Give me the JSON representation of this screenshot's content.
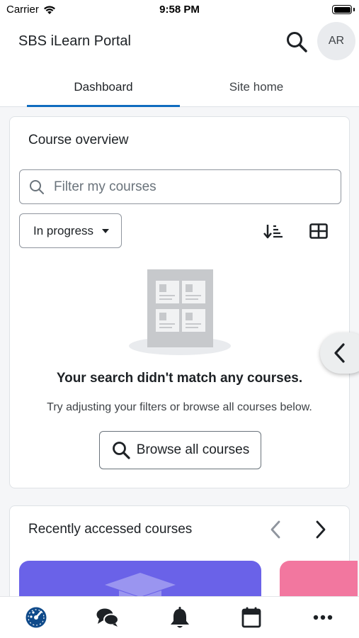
{
  "status_bar": {
    "carrier": "Carrier",
    "time": "9:58 PM"
  },
  "header": {
    "title": "SBS iLearn Portal",
    "avatar_initials": "AR"
  },
  "tabs": [
    {
      "label": "Dashboard",
      "active": true
    },
    {
      "label": "Site home",
      "active": false
    }
  ],
  "course_overview": {
    "title": "Course overview",
    "filter_placeholder": "Filter my courses",
    "grouping_selected": "In progress",
    "empty_title": "Your search didn't match any courses.",
    "empty_subtitle": "Try adjusting your filters or browse all courses below.",
    "browse_label": "Browse all courses"
  },
  "recent_courses": {
    "title": "Recently accessed courses",
    "tile_colors": [
      "#6a62e8",
      "#f2779f"
    ]
  },
  "bottom_tabs": [
    "dashboard-icon",
    "messages-icon",
    "notifications-icon",
    "calendar-icon",
    "more-icon"
  ],
  "colors": {
    "accent": "#0f6cbf",
    "dashboard_active": "#0f4a8a"
  }
}
